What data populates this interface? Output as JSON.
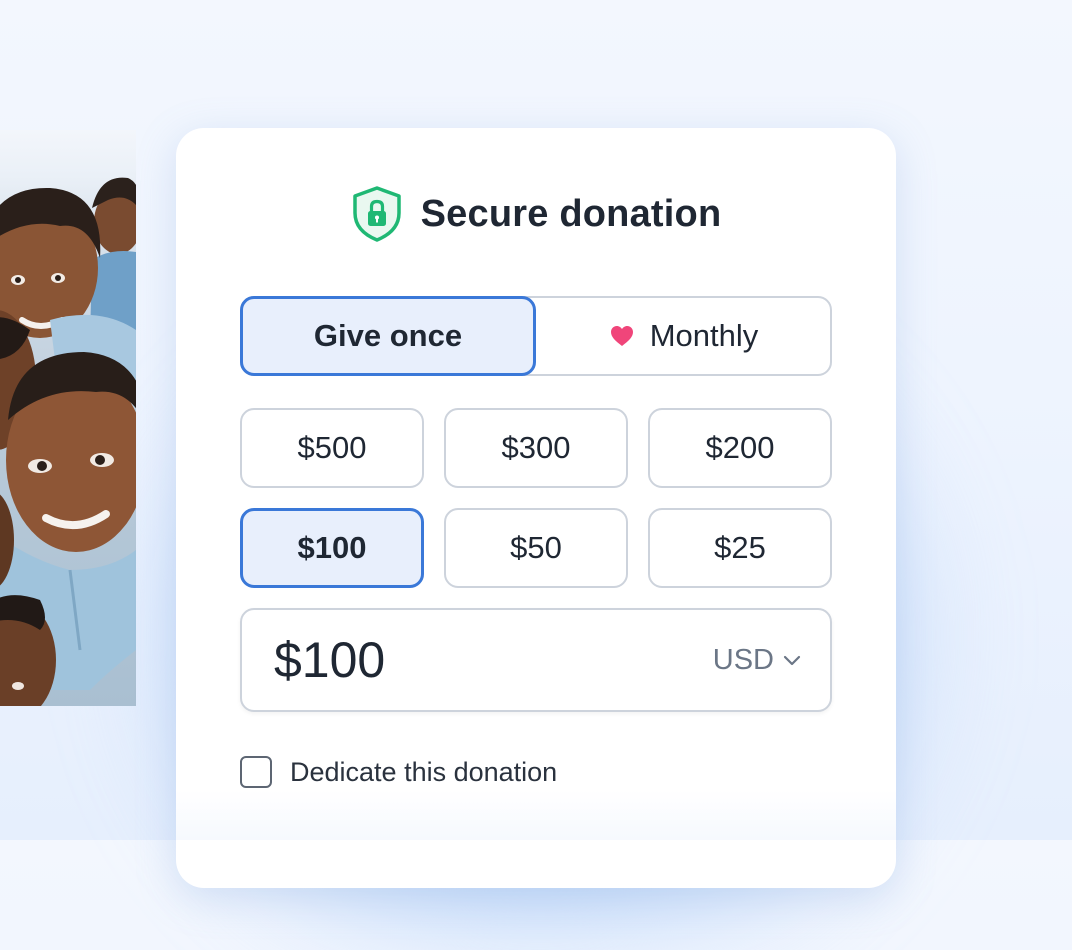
{
  "header": {
    "title": "Secure donation",
    "icon": "shield-lock-icon"
  },
  "frequency": {
    "once_label": "Give once",
    "monthly_label": "Monthly",
    "selected": "once"
  },
  "amount_options": [
    {
      "label": "$500",
      "selected": false
    },
    {
      "label": "$300",
      "selected": false
    },
    {
      "label": "$200",
      "selected": false
    },
    {
      "label": "$100",
      "selected": true
    },
    {
      "label": "$50",
      "selected": false
    },
    {
      "label": "$25",
      "selected": false
    }
  ],
  "amount_input": {
    "value": "$100",
    "currency": "USD"
  },
  "dedicate": {
    "label": "Dedicate this donation",
    "checked": false
  },
  "colors": {
    "accent": "#3a78d8",
    "selected_bg": "#e8effc",
    "shield": "#1fb874",
    "heart": "#f0457a",
    "text": "#1f2733"
  }
}
